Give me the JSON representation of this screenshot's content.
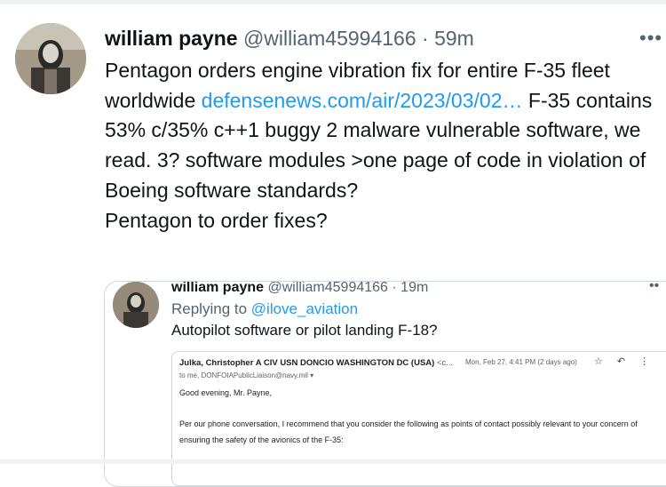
{
  "tweet": {
    "author_name": "william payne",
    "author_handle": "@william45994166",
    "separator": "·",
    "time": "59m",
    "more_icon": "more-horizontal-icon",
    "text_before_link": "Pentagon orders engine vibration fix for entire F-35 fleet worldwide ",
    "link_text": "defensenews.com/air/2023/03/02…",
    "text_after_link": " F-35 contains 53% c/35% c++1 buggy 2 malware vulnerable software, we read. 3? software modules >one page of code in violation of Boeing software standards?\nPentagon to order fixes?"
  },
  "quote": {
    "author_name": "william payne",
    "author_handle": "@william45994166",
    "separator": "·",
    "time": "19m",
    "more_icon": "more-horizontal-icon",
    "replying_prefix": "Replying to ",
    "replying_to": "@ilove_aviation",
    "text": "Autopilot software or pilot landing F-18?"
  },
  "email": {
    "from_name": "Julka, Christopher A CIV USN DONCIO WASHINGTON DC (USA)",
    "from_addr": "<c...",
    "date": "Mon, Feb 27, 4:41 PM (2 days ago)",
    "icons": [
      "star-icon",
      "reply-icon",
      "more-vertical-icon"
    ],
    "to": "to me, DONFOIAPublicLiaison@navy.mil ▾",
    "greeting": "Good evening, Mr. Payne,",
    "body": "Per our phone conversation, I recommend that you consider the following as points of contact possibly relevant to your concern of ensuring the safety of the avionics of the F-35:"
  },
  "colors": {
    "link": "#1d9bf0",
    "secondary_text": "#536471",
    "primary_text": "#0f1419",
    "border": "#cfd9de"
  }
}
